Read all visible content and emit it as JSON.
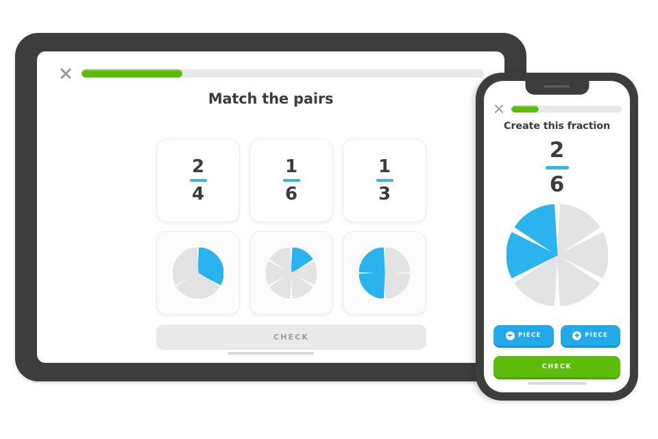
{
  "colors": {
    "bezel": "#3d3d3d",
    "accent_blue": "#21a9ea",
    "pie_blue": "#2bb3ef",
    "pie_gray": "#e3e3e3",
    "green": "#5bbd09",
    "progress_track": "#e8e8e8",
    "text_dark": "#3c3c3c",
    "disabled_text": "#9d9d9d",
    "fraction_bar_blue": "#35b5e8"
  },
  "tablet": {
    "close_icon": "close-x-icon",
    "progress": {
      "percent": 25,
      "label": "25"
    },
    "title": "Match the pairs",
    "cards": {
      "fractions": [
        {
          "numerator": "2",
          "denominator": "4"
        },
        {
          "numerator": "1",
          "denominator": "6"
        },
        {
          "numerator": "1",
          "denominator": "3"
        }
      ],
      "pies": [
        {
          "slices": 3,
          "filled": 1,
          "start_index": 0,
          "label": "1/3"
        },
        {
          "slices": 6,
          "filled": 1,
          "start_index": 0,
          "label": "1/6"
        },
        {
          "slices": 4,
          "filled": 2,
          "start_index": 2,
          "label": "2/4"
        }
      ]
    },
    "check_label": "CHECK",
    "check_enabled": false
  },
  "phone": {
    "close_icon": "close-x-icon",
    "progress": {
      "percent": 25,
      "label": "25"
    },
    "title": "Create this fraction",
    "fraction": {
      "numerator": "2",
      "denominator": "6"
    },
    "pie": {
      "slices": 6,
      "filled": 2,
      "start_index": 4,
      "label": "2/6"
    },
    "minus_button": {
      "label": "PIECE",
      "icon": "minus-circle-icon"
    },
    "plus_button": {
      "label": "PIECE",
      "icon": "plus-circle-icon"
    },
    "check_label": "CHECK"
  }
}
